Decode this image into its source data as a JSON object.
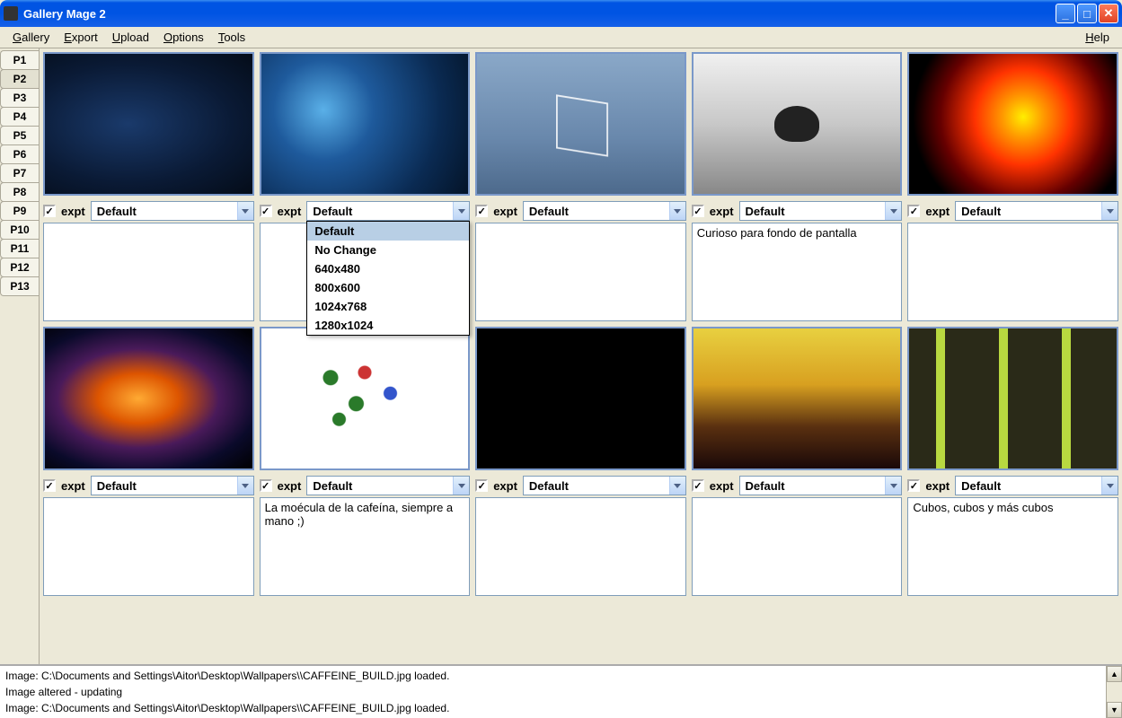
{
  "window": {
    "title": "Gallery Mage 2"
  },
  "menu": {
    "items": [
      "Gallery",
      "Export",
      "Upload",
      "Options",
      "Tools"
    ],
    "help": "Help"
  },
  "pages": [
    "P1",
    "P2",
    "P3",
    "P4",
    "P5",
    "P6",
    "P7",
    "P8",
    "P9",
    "P10",
    "P11",
    "P12",
    "P13"
  ],
  "selected_page": "P2",
  "expt_label": "expt",
  "dropdown_open_idx": 1,
  "dropdown_options": [
    "Default",
    "No Change",
    "640x480",
    "800x600",
    "1024x768",
    "1280x1024"
  ],
  "thumbs": [
    {
      "expt": true,
      "combo": "Default",
      "desc": ""
    },
    {
      "expt": true,
      "combo": "Default",
      "desc": ""
    },
    {
      "expt": true,
      "combo": "Default",
      "desc": ""
    },
    {
      "expt": true,
      "combo": "Default",
      "desc": "Curioso para fondo de pantalla"
    },
    {
      "expt": true,
      "combo": "Default",
      "desc": ""
    },
    {
      "expt": true,
      "combo": "Default",
      "desc": ""
    },
    {
      "expt": true,
      "combo": "Default",
      "desc": "La moécula de la cafeína, siempre a mano ;)"
    },
    {
      "expt": true,
      "combo": "Default",
      "desc": ""
    },
    {
      "expt": true,
      "combo": "Default",
      "desc": ""
    },
    {
      "expt": true,
      "combo": "Default",
      "desc": "Cubos, cubos y más cubos"
    }
  ],
  "status_lines": [
    "Image: C:\\Documents and Settings\\Aitor\\Desktop\\Wallpapers\\\\CAFFEINE_BUILD.jpg loaded.",
    "Image altered - updating",
    "Image: C:\\Documents and Settings\\Aitor\\Desktop\\Wallpapers\\\\CAFFEINE_BUILD.jpg loaded."
  ]
}
